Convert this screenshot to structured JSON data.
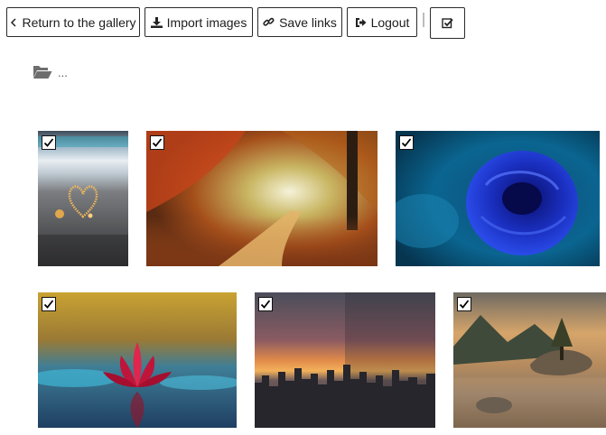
{
  "toolbar": {
    "return_label": "Return to the gallery",
    "import_label": "Import images",
    "save_label": "Save links",
    "logout_label": "Logout"
  },
  "breadcrumb": {
    "path": "..."
  },
  "images": [
    {
      "subject": "heart",
      "checked": true
    },
    {
      "subject": "autumn-forest-path",
      "checked": true
    },
    {
      "subject": "blue-rose",
      "checked": true
    },
    {
      "subject": "red-lotus",
      "checked": true
    },
    {
      "subject": "city-sunset",
      "checked": true
    },
    {
      "subject": "lake-island",
      "checked": true
    }
  ]
}
